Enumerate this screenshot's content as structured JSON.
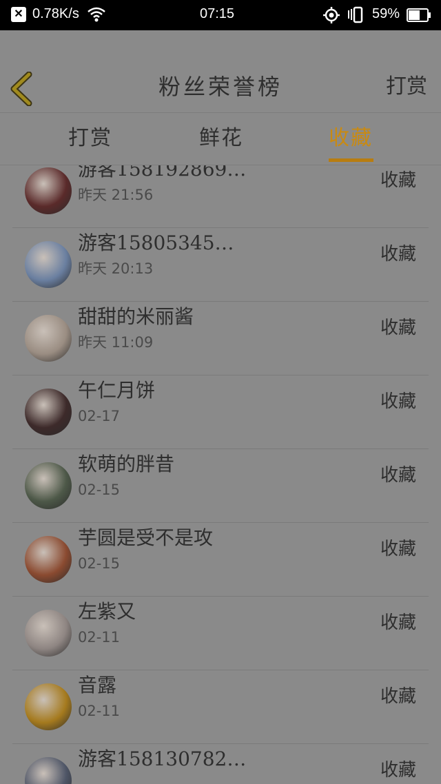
{
  "status_bar": {
    "close_glyph": "✕",
    "speed": "0.78K/s",
    "wifi_icon": "wifi-icon",
    "time": "07:15",
    "battery": "59%"
  },
  "header": {
    "title": "粉丝荣誉榜",
    "action": "打赏"
  },
  "tabs": [
    {
      "label": "打赏"
    },
    {
      "label": "鲜花"
    },
    {
      "label": "收藏"
    }
  ],
  "active_tab": "收藏",
  "colors": {
    "accent": "#c98a12",
    "overlay_bg": "#8a8a8a"
  },
  "rows": [
    {
      "name": "游客158192869…",
      "time": "昨天 21:56",
      "action": "收藏",
      "avatar": "#5a2a2a"
    },
    {
      "name": "游客15805345…",
      "time": "昨天 20:13",
      "action": "收藏",
      "avatar": "#6a7fa0"
    },
    {
      "name": "甜甜的米丽酱",
      "time": "昨天 11:09",
      "action": "收藏",
      "avatar": "#9a8d82"
    },
    {
      "name": "午仁月饼",
      "time": "02-17",
      "action": "收藏",
      "avatar": "#3d2a2a"
    },
    {
      "name": "软萌的胖昔",
      "time": "02-15",
      "action": "收藏",
      "avatar": "#4d5848"
    },
    {
      "name": "芋圆是受不是攻",
      "time": "02-15",
      "action": "收藏",
      "avatar": "#8a4a30"
    },
    {
      "name": "左紫又",
      "time": "02-11",
      "action": "收藏",
      "avatar": "#8e8582"
    },
    {
      "name": "音露",
      "time": "02-11",
      "action": "收藏",
      "avatar": "#a57a1e"
    },
    {
      "name": "游客158130782…",
      "time": "",
      "action": "收藏",
      "avatar": "#4e5566"
    }
  ]
}
